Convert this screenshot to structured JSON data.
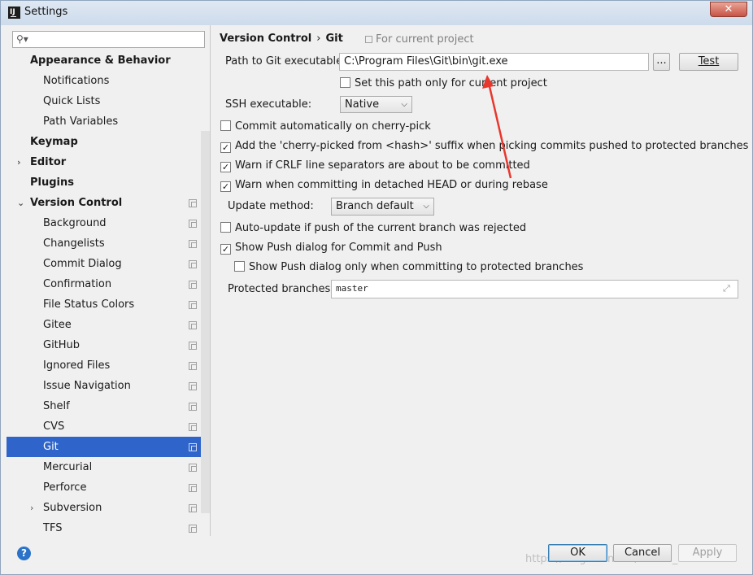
{
  "window": {
    "title": "Settings",
    "close_glyph": "✕"
  },
  "search": {
    "placeholder": "",
    "icon": "search-icon"
  },
  "tree": [
    {
      "label": "Appearance & Behavior",
      "level": 0,
      "bold": true,
      "arrow": "",
      "copy": false
    },
    {
      "label": "Notifications",
      "level": 1,
      "bold": false,
      "arrow": "",
      "copy": false
    },
    {
      "label": "Quick Lists",
      "level": 1,
      "bold": false,
      "arrow": "",
      "copy": false
    },
    {
      "label": "Path Variables",
      "level": 1,
      "bold": false,
      "arrow": "",
      "copy": false
    },
    {
      "label": "Keymap",
      "level": 0,
      "bold": true,
      "arrow": "",
      "copy": false
    },
    {
      "label": "Editor",
      "level": 0,
      "bold": true,
      "arrow": "›",
      "copy": false
    },
    {
      "label": "Plugins",
      "level": 0,
      "bold": true,
      "arrow": "",
      "copy": false
    },
    {
      "label": "Version Control",
      "level": 0,
      "bold": true,
      "arrow": "⌄",
      "copy": true
    },
    {
      "label": "Background",
      "level": 1,
      "bold": false,
      "arrow": "",
      "copy": true
    },
    {
      "label": "Changelists",
      "level": 1,
      "bold": false,
      "arrow": "",
      "copy": true
    },
    {
      "label": "Commit Dialog",
      "level": 1,
      "bold": false,
      "arrow": "",
      "copy": true
    },
    {
      "label": "Confirmation",
      "level": 1,
      "bold": false,
      "arrow": "",
      "copy": true
    },
    {
      "label": "File Status Colors",
      "level": 1,
      "bold": false,
      "arrow": "",
      "copy": true
    },
    {
      "label": "Gitee",
      "level": 1,
      "bold": false,
      "arrow": "",
      "copy": true
    },
    {
      "label": "GitHub",
      "level": 1,
      "bold": false,
      "arrow": "",
      "copy": true
    },
    {
      "label": "Ignored Files",
      "level": 1,
      "bold": false,
      "arrow": "",
      "copy": true
    },
    {
      "label": "Issue Navigation",
      "level": 1,
      "bold": false,
      "arrow": "",
      "copy": true
    },
    {
      "label": "Shelf",
      "level": 1,
      "bold": false,
      "arrow": "",
      "copy": true
    },
    {
      "label": "CVS",
      "level": 1,
      "bold": false,
      "arrow": "",
      "copy": true
    },
    {
      "label": "Git",
      "level": 1,
      "bold": false,
      "arrow": "",
      "copy": true,
      "selected": true
    },
    {
      "label": "Mercurial",
      "level": 1,
      "bold": false,
      "arrow": "",
      "copy": true
    },
    {
      "label": "Perforce",
      "level": 1,
      "bold": false,
      "arrow": "",
      "copy": true
    },
    {
      "label": "Subversion",
      "level": 1,
      "bold": false,
      "arrow": "›",
      "copy": true
    },
    {
      "label": "TFS",
      "level": 1,
      "bold": false,
      "arrow": "",
      "copy": true
    }
  ],
  "breadcrumb": {
    "parent": "Version Control",
    "separator": "›",
    "current": "Git",
    "scope": "For current project"
  },
  "git_path": {
    "label": "Path to Git executable:",
    "value": "C:\\Program Files\\Git\\bin\\git.exe",
    "browse": "...",
    "test": "Test"
  },
  "current_project_only": {
    "label": "Set this path only for current project",
    "checked": false
  },
  "ssh": {
    "label": "SSH executable:",
    "value": "Native"
  },
  "options": [
    {
      "label": "Commit automatically on cherry-pick",
      "checked": false
    },
    {
      "label": "Add the 'cherry-picked from <hash>' suffix when picking commits pushed to protected branches",
      "checked": true
    },
    {
      "label": "Warn if CRLF line separators are about to be committed",
      "checked": true
    },
    {
      "label": "Warn when committing in detached HEAD or during rebase",
      "checked": true
    }
  ],
  "update_method": {
    "label": "Update method:",
    "value": "Branch default"
  },
  "options2": [
    {
      "label": "Auto-update if push of the current branch was rejected",
      "checked": false
    },
    {
      "label": "Show Push dialog for Commit and Push",
      "checked": true
    },
    {
      "label": "Show Push dialog only when committing to protected branches",
      "checked": false
    }
  ],
  "protected_branches": {
    "label": "Protected branches:",
    "value": "master"
  },
  "footer": {
    "ok": "OK",
    "cancel": "Cancel",
    "apply": "Apply",
    "help": "?"
  },
  "watermark": "https://blog.csdn.net/weixin_43973003",
  "colors": {
    "selection": "#2f65ca",
    "annotation_arrow": "#e8372d"
  }
}
